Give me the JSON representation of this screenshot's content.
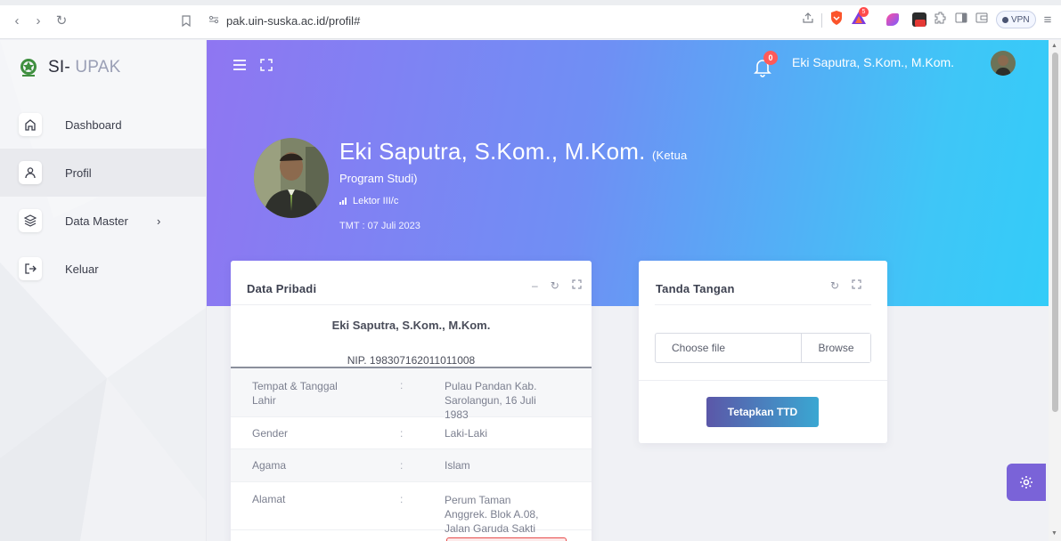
{
  "browser": {
    "url": "pak.uin-suska.ac.id/profil#",
    "vpn_label": "VPN",
    "shield_badge": "5"
  },
  "sidebar": {
    "brand_prefix": "SI-",
    "brand_suffix": "UPAK",
    "items": [
      {
        "label": "Dashboard",
        "icon": "home-icon"
      },
      {
        "label": "Profil",
        "icon": "user-icon"
      },
      {
        "label": "Data Master",
        "icon": "layers-icon"
      },
      {
        "label": "Keluar",
        "icon": "logout-icon"
      }
    ]
  },
  "topbar": {
    "notification_count": "0",
    "user_name": "Eki Saputra, S.Kom., M.Kom."
  },
  "profile": {
    "name": "Eki Saputra, S.Kom., M.Kom.",
    "role_part1": "(Ketua",
    "role_part2": "Program Studi)",
    "rank": "Lektor III/c",
    "tmt": "TMT : 07 Juli 2023"
  },
  "data_pribadi": {
    "title": "Data Pribadi",
    "name": "Eki Saputra, S.Kom., M.Kom.",
    "nip": "NIP. 198307162011011008",
    "rows": [
      {
        "key": "Tempat & Tanggal Lahir",
        "sep": ":",
        "value": "Pulau Pandan Kab. Sarolangun, 16 Juli 1983"
      },
      {
        "key": "Gender",
        "sep": ":",
        "value": "Laki-Laki"
      },
      {
        "key": "Agama",
        "sep": ":",
        "value": "Islam"
      },
      {
        "key": "Alamat",
        "sep": ":",
        "value": "Perum Taman Anggrek. Blok A.08, Jalan Garuda Sakti"
      }
    ]
  },
  "tanda_tangan": {
    "title": "Tanda Tangan",
    "file_placeholder": "Choose file",
    "browse_label": "Browse",
    "submit_label": "Tetapkan TTD"
  },
  "colors": {
    "accent": "#7a63d8",
    "hero_start": "#8f76f2",
    "hero_end": "#33ccf8",
    "danger": "#e74a4a"
  }
}
